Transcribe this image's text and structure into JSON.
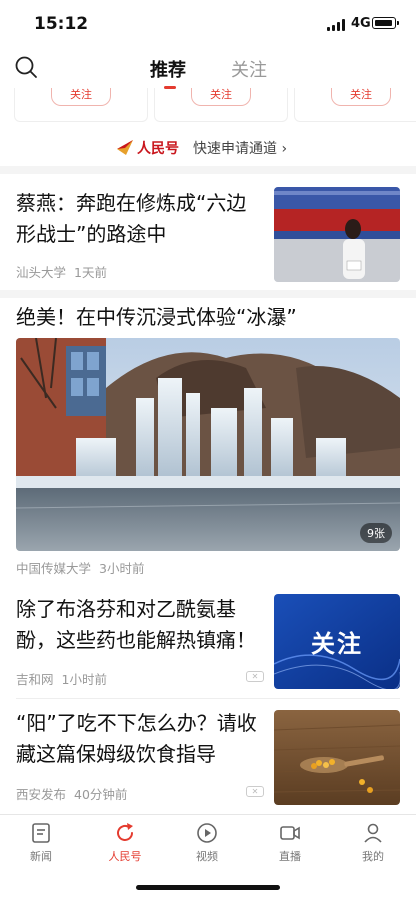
{
  "status": {
    "time": "15:12",
    "network": "4G"
  },
  "nav": {
    "tabs": [
      "推荐",
      "关注"
    ],
    "active": 0
  },
  "follow_cards": {
    "button_label": "关注"
  },
  "rmh": {
    "name": "人民号",
    "link": "快速申请通道"
  },
  "articles": [
    {
      "title": "蔡燕：奔跑在修炼成“六边形战士”的路途中",
      "source": "汕头大学",
      "time": "1天前",
      "thumb_label": ""
    },
    {
      "title": "绝美！在中传沉浸式体验“冰瀑”",
      "source": "中国传媒大学",
      "time": "3小时前",
      "image_count": "9张"
    },
    {
      "title": "除了布洛芬和对乙酰氨基酚，这些药也能解热镇痛！",
      "source": "吉和网",
      "time": "1小时前",
      "thumb_label": "关注"
    },
    {
      "title": "“阳”了吃不下怎么办？请收藏这篇保姆级饮食指导",
      "source": "西安发布",
      "time": "40分钟前"
    }
  ],
  "bottom_tabs": [
    {
      "label": "新闻",
      "icon": "news-icon"
    },
    {
      "label": "人民号",
      "icon": "refresh-icon"
    },
    {
      "label": "视频",
      "icon": "play-icon"
    },
    {
      "label": "直播",
      "icon": "camera-icon"
    },
    {
      "label": "我的",
      "icon": "user-icon"
    }
  ],
  "colors": {
    "accent": "#e43b2f",
    "brand": "#c9161d"
  }
}
